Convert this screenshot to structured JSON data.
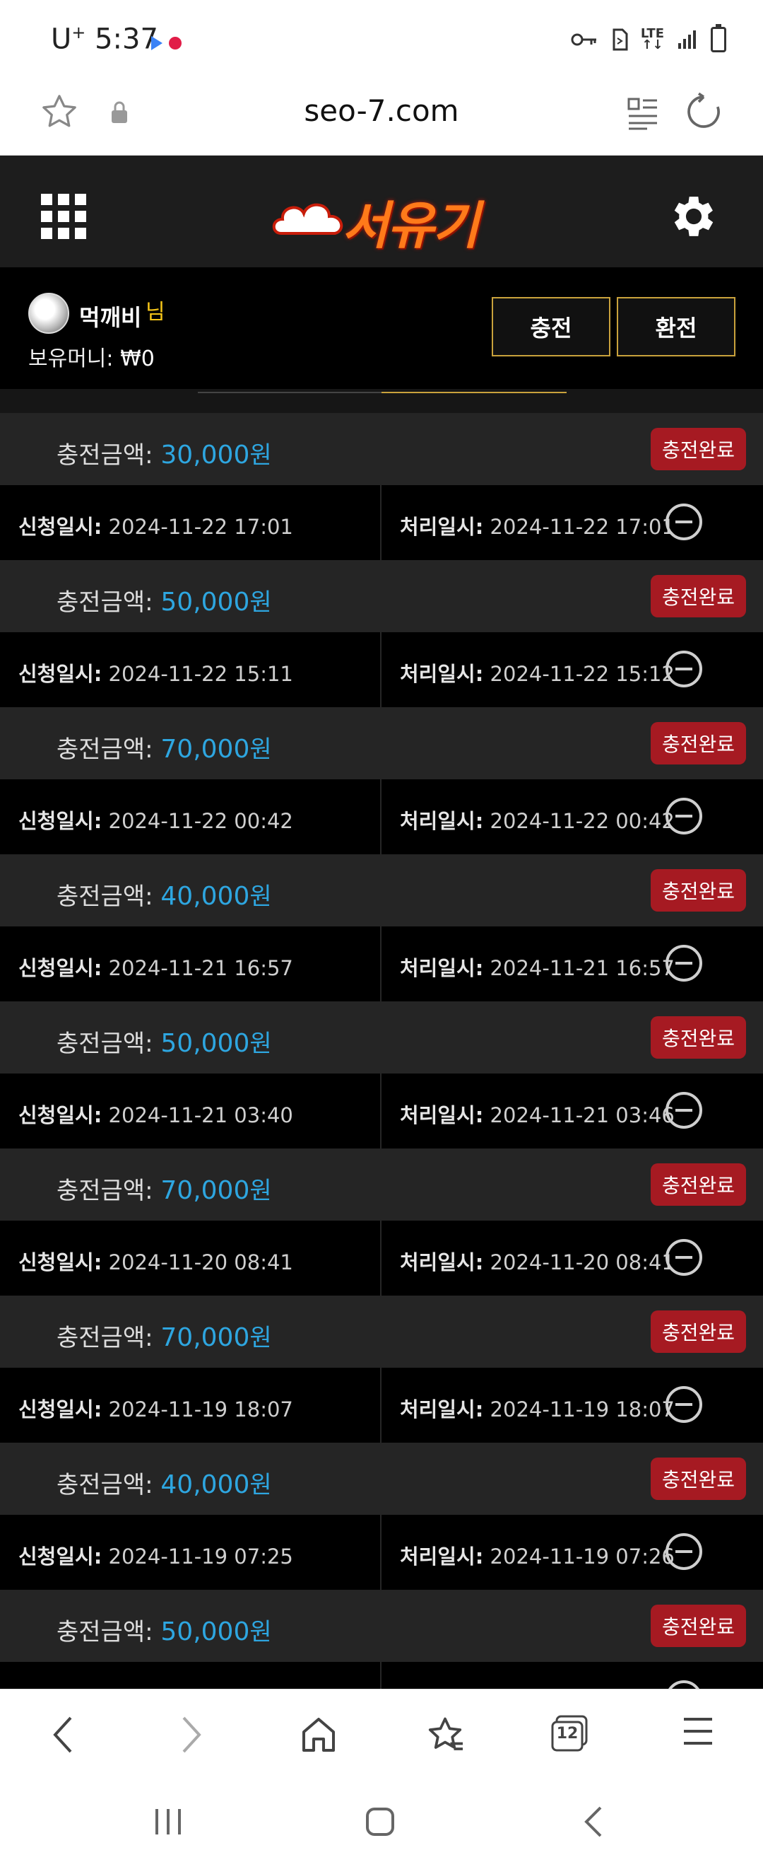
{
  "status_bar": {
    "carrier": "U",
    "carrier_sup": "+",
    "time": "5:37",
    "network": "LTE"
  },
  "browser": {
    "url": "seo-7.com",
    "tab_count": "12"
  },
  "site": {
    "logo_text": "서유기"
  },
  "user": {
    "name": "먹깨비",
    "suffix": "님",
    "money_label": "보유머니:",
    "money_value": "₩0",
    "charge_button": "충전",
    "exchange_button": "환전"
  },
  "labels": {
    "amount": "충전금액:",
    "unit": "원",
    "request": "신청일시:",
    "process": "처리일시:"
  },
  "records": [
    {
      "amount": "30,000",
      "status": "충전완료",
      "requested": "2024-11-22 17:01",
      "processed": "2024-11-22 17:01"
    },
    {
      "amount": "50,000",
      "status": "충전완료",
      "requested": "2024-11-22 15:11",
      "processed": "2024-11-22 15:12"
    },
    {
      "amount": "70,000",
      "status": "충전완료",
      "requested": "2024-11-22 00:42",
      "processed": "2024-11-22 00:42"
    },
    {
      "amount": "40,000",
      "status": "충전완료",
      "requested": "2024-11-21 16:57",
      "processed": "2024-11-21 16:57"
    },
    {
      "amount": "50,000",
      "status": "충전완료",
      "requested": "2024-11-21 03:40",
      "processed": "2024-11-21 03:46"
    },
    {
      "amount": "70,000",
      "status": "충전완료",
      "requested": "2024-11-20 08:41",
      "processed": "2024-11-20 08:41"
    },
    {
      "amount": "70,000",
      "status": "충전완료",
      "requested": "2024-11-19 18:07",
      "processed": "2024-11-19 18:07"
    },
    {
      "amount": "40,000",
      "status": "충전완료",
      "requested": "2024-11-19 07:25",
      "processed": "2024-11-19 07:26"
    },
    {
      "amount": "50,000",
      "status": "충전완료",
      "requested": "",
      "processed": ""
    }
  ],
  "colors": {
    "amount": "#2ea6e0",
    "badge": "#a61a22",
    "button_border": "#c9a23c",
    "nim": "#f5c518"
  }
}
